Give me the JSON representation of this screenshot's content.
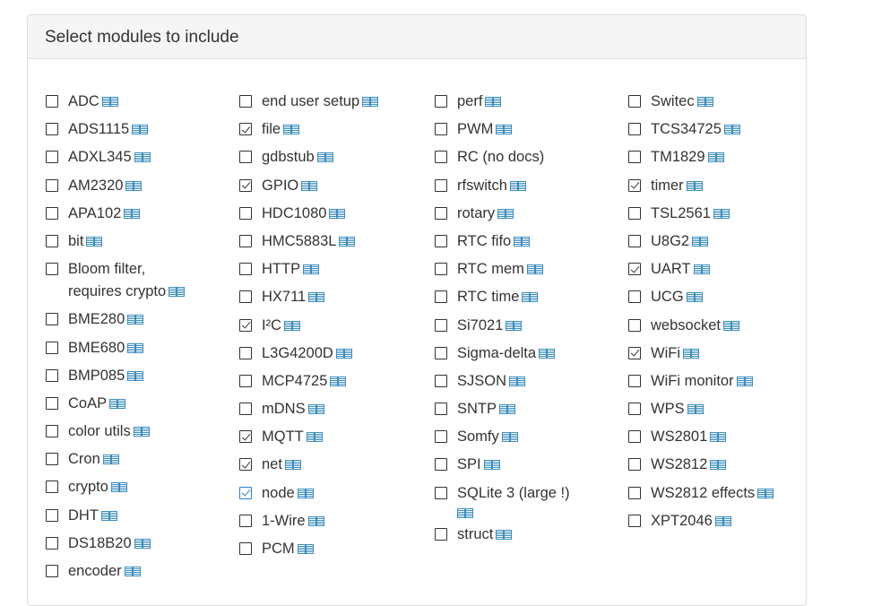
{
  "panel": {
    "title": "Select modules to include"
  },
  "modules": [
    [
      {
        "label": "ADC",
        "checked": false,
        "doc": true
      },
      {
        "label": "ADS1115",
        "checked": false,
        "doc": true
      },
      {
        "label": "ADXL345",
        "checked": false,
        "doc": true
      },
      {
        "label": "AM2320",
        "checked": false,
        "doc": true
      },
      {
        "label": "APA102",
        "checked": false,
        "doc": true
      },
      {
        "label": "bit",
        "checked": false,
        "doc": true
      },
      {
        "label": "Bloom filter, requires crypto",
        "checked": false,
        "doc": true,
        "wrap": true
      },
      {
        "label": "BME280",
        "checked": false,
        "doc": true
      },
      {
        "label": "BME680",
        "checked": false,
        "doc": true
      },
      {
        "label": "BMP085",
        "checked": false,
        "doc": true
      },
      {
        "label": "CoAP",
        "checked": false,
        "doc": true
      },
      {
        "label": "color utils",
        "checked": false,
        "doc": true
      },
      {
        "label": "Cron",
        "checked": false,
        "doc": true
      },
      {
        "label": "crypto",
        "checked": false,
        "doc": true
      },
      {
        "label": "DHT",
        "checked": false,
        "doc": true
      },
      {
        "label": "DS18B20",
        "checked": false,
        "doc": true
      },
      {
        "label": "encoder",
        "checked": false,
        "doc": true
      }
    ],
    [
      {
        "label": "end user setup",
        "checked": false,
        "doc": true
      },
      {
        "label": "file",
        "checked": true,
        "doc": true
      },
      {
        "label": "gdbstub",
        "checked": false,
        "doc": true
      },
      {
        "label": "GPIO",
        "checked": true,
        "doc": true
      },
      {
        "label": "HDC1080",
        "checked": false,
        "doc": true
      },
      {
        "label": "HMC5883L",
        "checked": false,
        "doc": true
      },
      {
        "label": "HTTP",
        "checked": false,
        "doc": true
      },
      {
        "label": "HX711",
        "checked": false,
        "doc": true
      },
      {
        "label": "I²C",
        "checked": true,
        "doc": true
      },
      {
        "label": "L3G4200D",
        "checked": false,
        "doc": true
      },
      {
        "label": "MCP4725",
        "checked": false,
        "doc": true
      },
      {
        "label": "mDNS",
        "checked": false,
        "doc": true
      },
      {
        "label": "MQTT",
        "checked": true,
        "doc": true
      },
      {
        "label": "net",
        "checked": true,
        "doc": true
      },
      {
        "label": "node",
        "checked": true,
        "doc": true,
        "focus": true
      },
      {
        "label": "1-Wire",
        "checked": false,
        "doc": true
      },
      {
        "label": "PCM",
        "checked": false,
        "doc": true
      }
    ],
    [
      {
        "label": "perf",
        "checked": false,
        "doc": true
      },
      {
        "label": "PWM",
        "checked": false,
        "doc": true
      },
      {
        "label": "RC (no docs)",
        "checked": false,
        "doc": false
      },
      {
        "label": "rfswitch",
        "checked": false,
        "doc": true
      },
      {
        "label": "rotary",
        "checked": false,
        "doc": true
      },
      {
        "label": "RTC fifo",
        "checked": false,
        "doc": true
      },
      {
        "label": "RTC mem",
        "checked": false,
        "doc": true
      },
      {
        "label": "RTC time",
        "checked": false,
        "doc": true
      },
      {
        "label": "Si7021",
        "checked": false,
        "doc": true
      },
      {
        "label": "Sigma-delta",
        "checked": false,
        "doc": true
      },
      {
        "label": "SJSON",
        "checked": false,
        "doc": true
      },
      {
        "label": "SNTP",
        "checked": false,
        "doc": true
      },
      {
        "label": "Somfy",
        "checked": false,
        "doc": true
      },
      {
        "label": "SPI",
        "checked": false,
        "doc": true
      },
      {
        "label": "SQLite 3 (large !)",
        "checked": false,
        "doc": true,
        "wrap": true
      },
      {
        "label": "struct",
        "checked": false,
        "doc": true
      }
    ],
    [
      {
        "label": "Switec",
        "checked": false,
        "doc": true
      },
      {
        "label": "TCS34725",
        "checked": false,
        "doc": true
      },
      {
        "label": "TM1829",
        "checked": false,
        "doc": true
      },
      {
        "label": "timer",
        "checked": true,
        "doc": true
      },
      {
        "label": "TSL2561",
        "checked": false,
        "doc": true
      },
      {
        "label": "U8G2",
        "checked": false,
        "doc": true
      },
      {
        "label": "UART",
        "checked": true,
        "doc": true
      },
      {
        "label": "UCG",
        "checked": false,
        "doc": true
      },
      {
        "label": "websocket",
        "checked": false,
        "doc": true
      },
      {
        "label": "WiFi",
        "checked": true,
        "doc": true
      },
      {
        "label": "WiFi monitor",
        "checked": false,
        "doc": true
      },
      {
        "label": "WPS",
        "checked": false,
        "doc": true
      },
      {
        "label": "WS2801",
        "checked": false,
        "doc": true
      },
      {
        "label": "WS2812",
        "checked": false,
        "doc": true
      },
      {
        "label": "WS2812 effects",
        "checked": false,
        "doc": true
      },
      {
        "label": "XPT2046",
        "checked": false,
        "doc": true
      }
    ]
  ],
  "icons": {
    "checkbox": "checkbox-icon",
    "doc": "book-icon"
  },
  "colors": {
    "doc_icon": "#3c8dbc",
    "focus_check": "#2f7fc8",
    "heading_bg": "#f5f5f5"
  }
}
